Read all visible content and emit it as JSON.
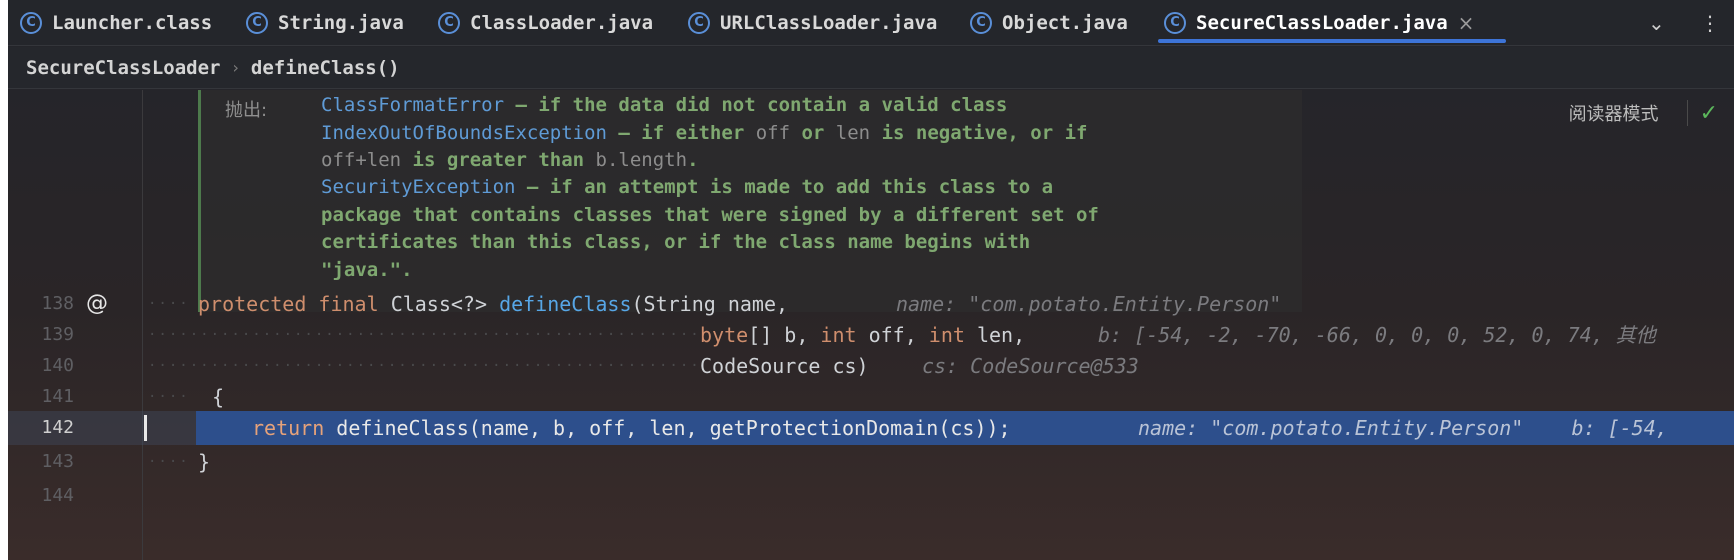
{
  "tabs": [
    {
      "label": "Launcher.class",
      "active": false
    },
    {
      "label": "String.java",
      "active": false
    },
    {
      "label": "ClassLoader.java",
      "active": false
    },
    {
      "label": "URLClassLoader.java",
      "active": false
    },
    {
      "label": "Object.java",
      "active": false
    },
    {
      "label": "SecureClassLoader.java",
      "active": true
    }
  ],
  "tab_icon_glyph": "C",
  "tab_close_glyph": "×",
  "tab_overflow_glyph": "⌄",
  "tab_menu_glyph": "⋮",
  "breadcrumb": {
    "class_name": "SecureClassLoader",
    "separator": "›",
    "method_name": "defineClass()"
  },
  "reader_mode": {
    "label": "阅读器模式",
    "check_glyph": "✓"
  },
  "doc": {
    "label": "抛出:",
    "lines": [
      {
        "link": "ClassFormatError",
        "text": " – if the data did not contain a valid class"
      },
      {
        "link": "IndexOutOfBoundsException",
        "text": " – if either ",
        "c1": "off",
        "t2": " or ",
        "c2": "len",
        "t3": " is negative, or if"
      },
      {
        "c1": "off+len",
        "t2": " is greater than ",
        "c2": "b.length",
        "t3": "."
      },
      {
        "link": "SecurityException",
        "text": " – if an attempt is made to add this class to a"
      },
      {
        "text": "package that contains classes that were signed by a different set of"
      },
      {
        "text": "certificates than this class, or if the class name begins with"
      },
      {
        "text": "\"java.\"."
      }
    ]
  },
  "code": {
    "l138": {
      "no": "138",
      "gutter_icon": "@",
      "kw1": "protected",
      "kw2": "final",
      "t1": "Class<?>",
      "fn": "defineClass",
      "t2": "(String name,",
      "hint": "name: \"com.potato.Entity.Person\""
    },
    "l139": {
      "no": "139",
      "t1": "byte",
      "t2": "[] b, ",
      "kw1": "int",
      "t3": " off, ",
      "kw2": "int",
      "t4": " len,",
      "hint": "b: [-54, -2, -70, -66, 0, 0, 0, 52, 0, 74, 其他"
    },
    "l140": {
      "no": "140",
      "t1": "CodeSource cs)",
      "hint": "cs: CodeSource@533"
    },
    "l141": {
      "no": "141",
      "t1": "{"
    },
    "l142": {
      "no": "142",
      "kw": "return",
      "t1": "defineClass(name, b, off, len, getProtectionDomain(cs));",
      "hint": "name: \"com.potato.Entity.Person\"    b: [-54,"
    },
    "l143": {
      "no": "143",
      "t1": "}"
    },
    "l144": {
      "no": "144"
    }
  },
  "colors": {
    "accent": "#3d74d8",
    "keyword": "#cf8e6d",
    "function": "#57a6e6",
    "doc_text": "#7fa870",
    "selection": "#2d4f8c"
  }
}
